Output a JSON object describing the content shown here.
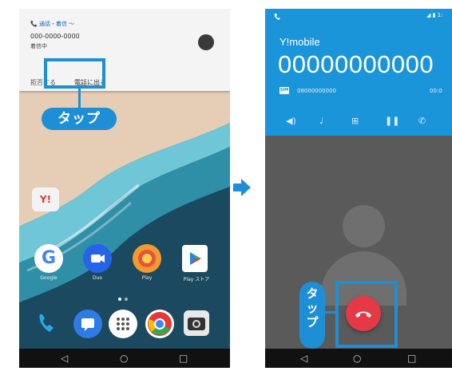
{
  "left_screen": {
    "notification": {
      "status_line": "📞 通話・着信 ～",
      "caller_number": "000-0000-0000",
      "caller_state": "着信中",
      "actions": [
        "拒否する",
        "電話に出る"
      ]
    },
    "apps_row1_label": "Y!",
    "dock_apps": [
      "Google",
      "Duo",
      "Play",
      "Play ストア"
    ],
    "callout": "タップ"
  },
  "right_screen": {
    "carrier": "Y!mobile",
    "number": "00000000000",
    "sub_number": "08000000000",
    "duration": "00:0",
    "status_time": "1:",
    "callout": "タップ"
  },
  "colors": {
    "callout_blue": "#1e8fd6",
    "call_blue": "#1b95d9",
    "end_call_red": "#e53946"
  }
}
